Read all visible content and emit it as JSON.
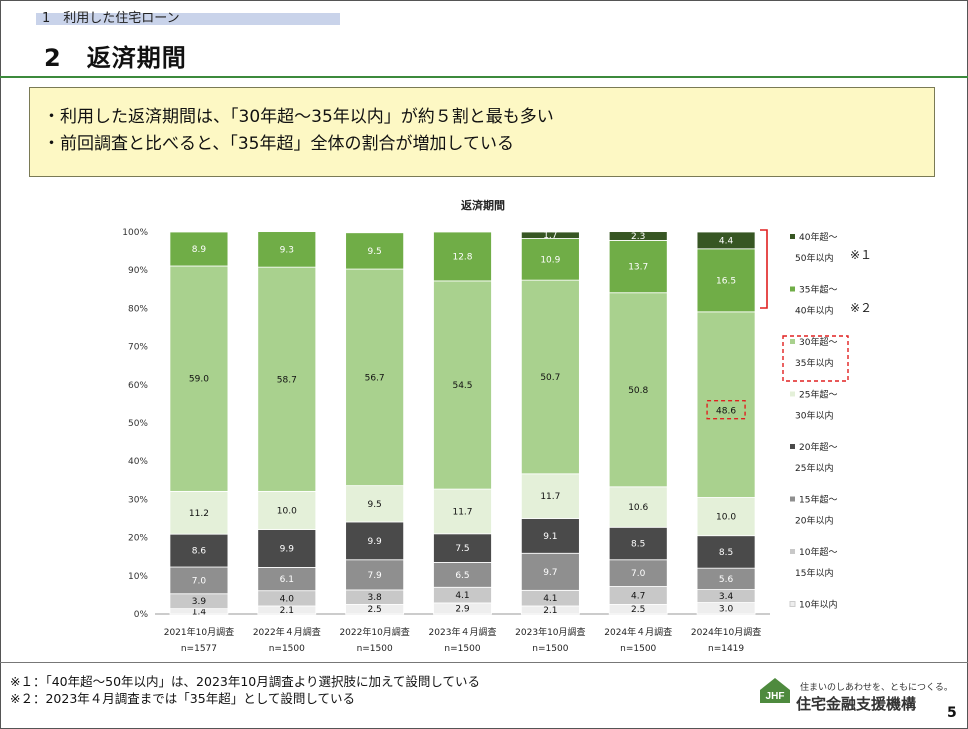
{
  "header": {
    "section_label": "1　利用した住宅ローン",
    "page_title": "2　返済期間"
  },
  "summary": [
    "・利用した返済期間は、「30年超～35年以内」が約５割と最も多い",
    "・前回調査と比べると、「35年超」全体の割合が増加している"
  ],
  "chart_data": {
    "type": "bar",
    "stacked": true,
    "title": "返済期間",
    "ylim": [
      0,
      100
    ],
    "yticks": [
      "0%",
      "10%",
      "20%",
      "30%",
      "40%",
      "50%",
      "60%",
      "70%",
      "80%",
      "90%",
      "100%"
    ],
    "categories": [
      "2021年10月調査",
      "2022年４月調査",
      "2022年10月調査",
      "2023年４月調査",
      "2023年10月調査",
      "2024年４月調査",
      "2024年10月調査"
    ],
    "n_labels": [
      "n=1577",
      "n=1500",
      "n=1500",
      "n=1500",
      "n=1500",
      "n=1500",
      "n=1419"
    ],
    "series": [
      {
        "name": "10年以内",
        "legend_lines": [
          "10年以内"
        ],
        "color": "#eeeeee",
        "label_color": "#111111",
        "values": [
          1.4,
          2.1,
          2.5,
          2.9,
          2.1,
          2.5,
          3.0
        ]
      },
      {
        "name": "10年超～15年以内",
        "legend_lines": [
          "10年超～",
          "15年以内"
        ],
        "color": "#c8c8c8",
        "label_color": "#111111",
        "values": [
          3.9,
          4.0,
          3.8,
          4.1,
          4.1,
          4.7,
          3.4
        ]
      },
      {
        "name": "15年超～20年以内",
        "legend_lines": [
          "15年超～",
          "20年以内"
        ],
        "color": "#8f8f8f",
        "label_color": "#ffffff",
        "values": [
          7.0,
          6.1,
          7.9,
          6.5,
          9.7,
          7.0,
          5.6
        ]
      },
      {
        "name": "20年超～25年以内",
        "legend_lines": [
          "20年超～",
          "25年以内"
        ],
        "color": "#4a4a4a",
        "label_color": "#ffffff",
        "values": [
          8.6,
          9.9,
          9.9,
          7.5,
          9.1,
          8.5,
          8.5
        ]
      },
      {
        "name": "25年超～30年以内",
        "legend_lines": [
          "25年超～",
          "30年以内"
        ],
        "color": "#e4f0d9",
        "label_color": "#111111",
        "values": [
          11.2,
          10.0,
          9.5,
          11.7,
          11.7,
          10.6,
          10.0
        ]
      },
      {
        "name": "30年超～35年以内",
        "legend_lines": [
          "30年超～",
          "35年以内"
        ],
        "color": "#a9d18e",
        "label_color": "#111111",
        "values": [
          59.0,
          58.7,
          56.7,
          54.5,
          50.7,
          50.8,
          48.6
        ]
      },
      {
        "name": "35年超～40年以内",
        "legend_lines": [
          "35年超～",
          "40年以内"
        ],
        "color": "#70ad47",
        "label_color": "#ffffff",
        "values": [
          8.9,
          9.3,
          9.5,
          12.8,
          10.9,
          13.7,
          16.5
        ]
      },
      {
        "name": "40年超～50年以内",
        "legend_lines": [
          "40年超～",
          "50年以内"
        ],
        "color": "#375623",
        "label_color": "#ffffff",
        "values": [
          null,
          null,
          null,
          null,
          1.7,
          2.3,
          4.4
        ]
      }
    ],
    "legend_notes": [
      "※１",
      "※２"
    ]
  },
  "footnotes": [
    "※１：「40年超～50年以内」は、2023年10月調査より選択肢に加えて設問している",
    "※２：2023年４月調査までは「35年超」として設問している"
  ],
  "footer": {
    "tagline": "住まいのしあわせを、ともにつくる。",
    "org_name": "住宅金融支援機構",
    "logo_text": "JHF",
    "page_number": "5"
  }
}
